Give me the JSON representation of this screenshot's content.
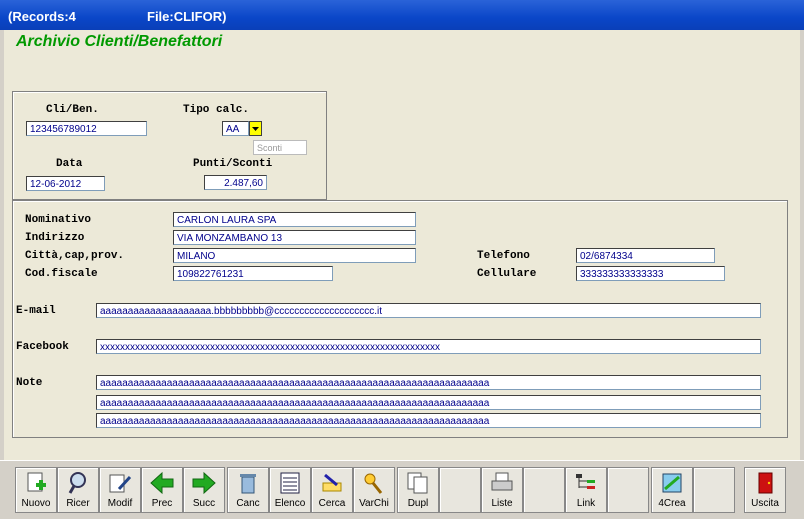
{
  "titlebar": {
    "records": "(Records:4",
    "file": "File:CLIFOR)"
  },
  "app": {
    "title": "Archivio Clienti/Benefattori"
  },
  "top": {
    "cli_label": "Cli/Ben.",
    "cli_value": "123456789012",
    "tipo_label": "Tipo calc.",
    "tipo_value": "AA",
    "sconti_placeholder": "Sconti",
    "data_label": "Data",
    "data_value": "12-06-2012",
    "punti_label": "Punti/Sconti",
    "punti_value": "2.487,60"
  },
  "details": {
    "nominativo_label": "Nominativo",
    "nominativo": "CARLON LAURA SPA",
    "indirizzo_label": "Indirizzo",
    "indirizzo": "VIA MONZAMBANO 13",
    "citta_label": "Città,cap,prov.",
    "citta": "MILANO",
    "codfiscale_label": "Cod.fiscale",
    "codfiscale": "109822761231",
    "telefono_label": "Telefono",
    "telefono": "02/6874334",
    "cellulare_label": "Cellulare",
    "cellulare": "333333333333333",
    "email_label": "E-mail",
    "email": "aaaaaaaaaaaaaaaaaaaa.bbbbbbbbb@cccccccccccccccccccc.it",
    "facebook_label": "Facebook",
    "facebook": "xxxxxxxxxxxxxxxxxxxxxxxxxxxxxxxxxxxxxxxxxxxxxxxxxxxxxxxxxxxxxxxxxxxx",
    "note_label": "Note",
    "note1": "aaaaaaaaaaaaaaaaaaaaaaaaaaaaaaaaaaaaaaaaaaaaaaaaaaaaaaaaaaaaaaaaaaaaaa",
    "note2": "aaaaaaaaaaaaaaaaaaaaaaaaaaaaaaaaaaaaaaaaaaaaaaaaaaaaaaaaaaaaaaaaaaaaaa",
    "note3": "aaaaaaaaaaaaaaaaaaaaaaaaaaaaaaaaaaaaaaaaaaaaaaaaaaaaaaaaaaaaaaaaaaaaaa"
  },
  "toolbar": {
    "nuovo": "Nuovo",
    "ricer": "Ricer",
    "modif": "Modif",
    "prec": "Prec",
    "succ": "Succ",
    "canc": "Canc",
    "elenco": "Elenco",
    "cerca": "Cerca",
    "varchi": "VarChi",
    "dupl": "Dupl",
    "liste": "Liste",
    "link": "Link",
    "crea4": "4Crea",
    "uscita": "Uscita"
  }
}
